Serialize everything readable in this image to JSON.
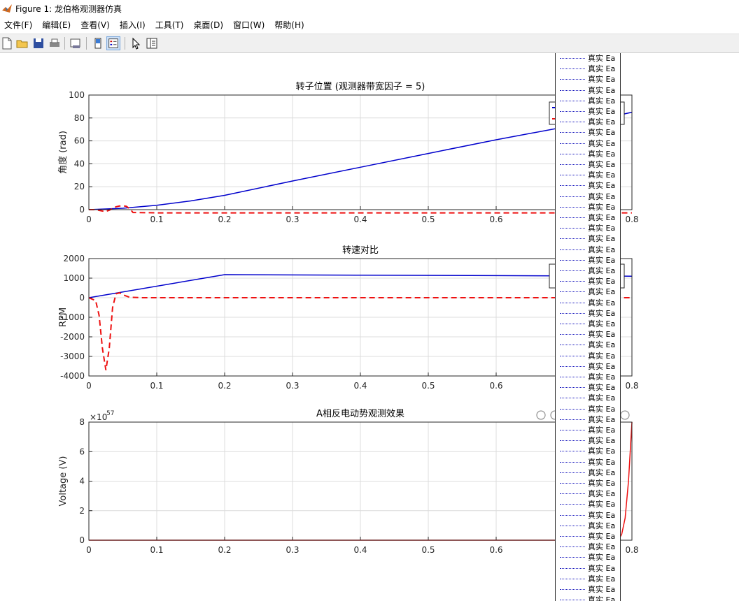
{
  "window": {
    "title": "Figure 1: 龙伯格观测器仿真"
  },
  "menu": [
    "文件(F)",
    "编辑(E)",
    "查看(V)",
    "插入(I)",
    "工具(T)",
    "桌面(D)",
    "窗口(W)",
    "帮助(H)"
  ],
  "toolbar": [
    "new-figure-icon",
    "open-icon",
    "save-icon",
    "print-icon",
    "link-plot-icon",
    "colorbar-icon",
    "legend-icon",
    "select-arrow-icon",
    "property-inspector-icon"
  ],
  "axes_toolbar": [
    "brush-icon",
    "data-tips-icon",
    "restore-view-icon",
    "pan-icon",
    "zoom-in-icon",
    "zoom-out-icon",
    "home-icon"
  ],
  "colors": {
    "blue": "#0000cc",
    "red": "#ee1111",
    "grid": "#dcdcdc"
  },
  "legend_entry_text": "真实 Ea",
  "legend_row_count": 52,
  "chart_data": [
    {
      "type": "line",
      "title": "转子位置 (观测器带宽因子 = 5)",
      "ylabel": "角度 (rad)",
      "xlim": [
        0,
        0.8
      ],
      "ylim": [
        0,
        100
      ],
      "xticks": [
        "0",
        "0.1",
        "0.2",
        "0.3",
        "0.4",
        "0.5",
        "0.6",
        "0.7",
        "0.8"
      ],
      "yticks": [
        "0",
        "20",
        "40",
        "60",
        "80",
        "100"
      ],
      "grid": true,
      "series": [
        {
          "color": "blue",
          "style": "solid",
          "x": [
            0,
            0.05,
            0.1,
            0.15,
            0.2,
            0.3,
            0.4,
            0.5,
            0.6,
            0.7,
            0.8
          ],
          "y": [
            0,
            1.2,
            3.8,
            7.6,
            12.5,
            25,
            37,
            49,
            61,
            72,
            85
          ]
        },
        {
          "color": "red",
          "style": "dashed",
          "x": [
            0,
            0.01,
            0.02,
            0.025,
            0.03,
            0.035,
            0.04,
            0.045,
            0.05,
            0.055,
            0.06,
            0.065,
            0.1,
            0.2,
            0.4,
            0.6,
            0.8
          ],
          "y": [
            0,
            0,
            -1.2,
            -1.5,
            -0.5,
            1,
            2.5,
            3.2,
            3.3,
            3,
            1,
            -2.5,
            -2.8,
            -2.8,
            -2.8,
            -2.8,
            -2.8
          ]
        }
      ]
    },
    {
      "type": "line",
      "title": "转速对比",
      "ylabel": "RPM",
      "xlim": [
        0,
        0.8
      ],
      "ylim": [
        -4000,
        2000
      ],
      "xticks": [
        "0",
        "0.1",
        "0.2",
        "0.3",
        "0.4",
        "0.5",
        "0.6",
        "0.7",
        "0.8"
      ],
      "yticks": [
        "-4000",
        "-3000",
        "-2000",
        "-1000",
        "0",
        "1000",
        "2000"
      ],
      "grid": true,
      "series": [
        {
          "color": "blue",
          "style": "solid",
          "x": [
            0,
            0.2,
            0.4,
            0.6,
            0.8
          ],
          "y": [
            0,
            1180,
            1150,
            1130,
            1100
          ]
        },
        {
          "color": "red",
          "style": "dashed",
          "x": [
            0,
            0.01,
            0.015,
            0.02,
            0.025,
            0.03,
            0.035,
            0.04,
            0.045,
            0.05,
            0.06,
            0.08,
            0.8
          ],
          "y": [
            0,
            -150,
            -900,
            -2600,
            -3700,
            -2600,
            -500,
            200,
            250,
            150,
            20,
            0,
            0
          ]
        }
      ]
    },
    {
      "type": "line",
      "title": "A相反电动势观测效果",
      "ylabel": "Voltage (V)",
      "exponent_label": "×10",
      "exponent_power": "57",
      "xlim": [
        0,
        0.8
      ],
      "ylim": [
        0,
        8
      ],
      "xticks": [
        "0",
        "0.1",
        "0.2",
        "0.3",
        "0.4",
        "0.5",
        "0.6",
        "0.7",
        "0.8"
      ],
      "yticks": [
        "0",
        "2",
        "4",
        "6",
        "8"
      ],
      "grid": true,
      "series": [
        {
          "color": "red",
          "style": "solid",
          "x": [
            0,
            0.7,
            0.78,
            0.785,
            0.79,
            0.795,
            0.8
          ],
          "y": [
            0,
            0,
            0,
            0.4,
            1.5,
            4,
            8
          ]
        }
      ]
    }
  ]
}
